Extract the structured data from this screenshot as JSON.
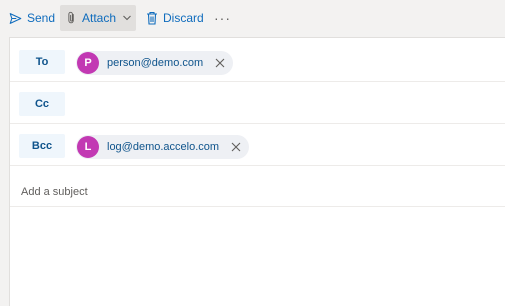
{
  "toolbar": {
    "send_label": "Send",
    "attach_label": "Attach",
    "discard_label": "Discard",
    "more_label": "···"
  },
  "recipients": {
    "to": {
      "label": "To",
      "chips": [
        {
          "initial": "P",
          "address": "person@demo.com",
          "avatar_color": "#c239b3"
        }
      ]
    },
    "cc": {
      "label": "Cc",
      "chips": []
    },
    "bcc": {
      "label": "Bcc",
      "chips": [
        {
          "initial": "L",
          "address": "log@demo.accelo.com",
          "avatar_color": "#c239b3"
        }
      ]
    }
  },
  "subject": {
    "value": "",
    "placeholder": "Add a subject"
  },
  "colors": {
    "accent": "#0f6cbd",
    "avatar": "#c239b3",
    "field_button_bg": "#eff6fc"
  }
}
